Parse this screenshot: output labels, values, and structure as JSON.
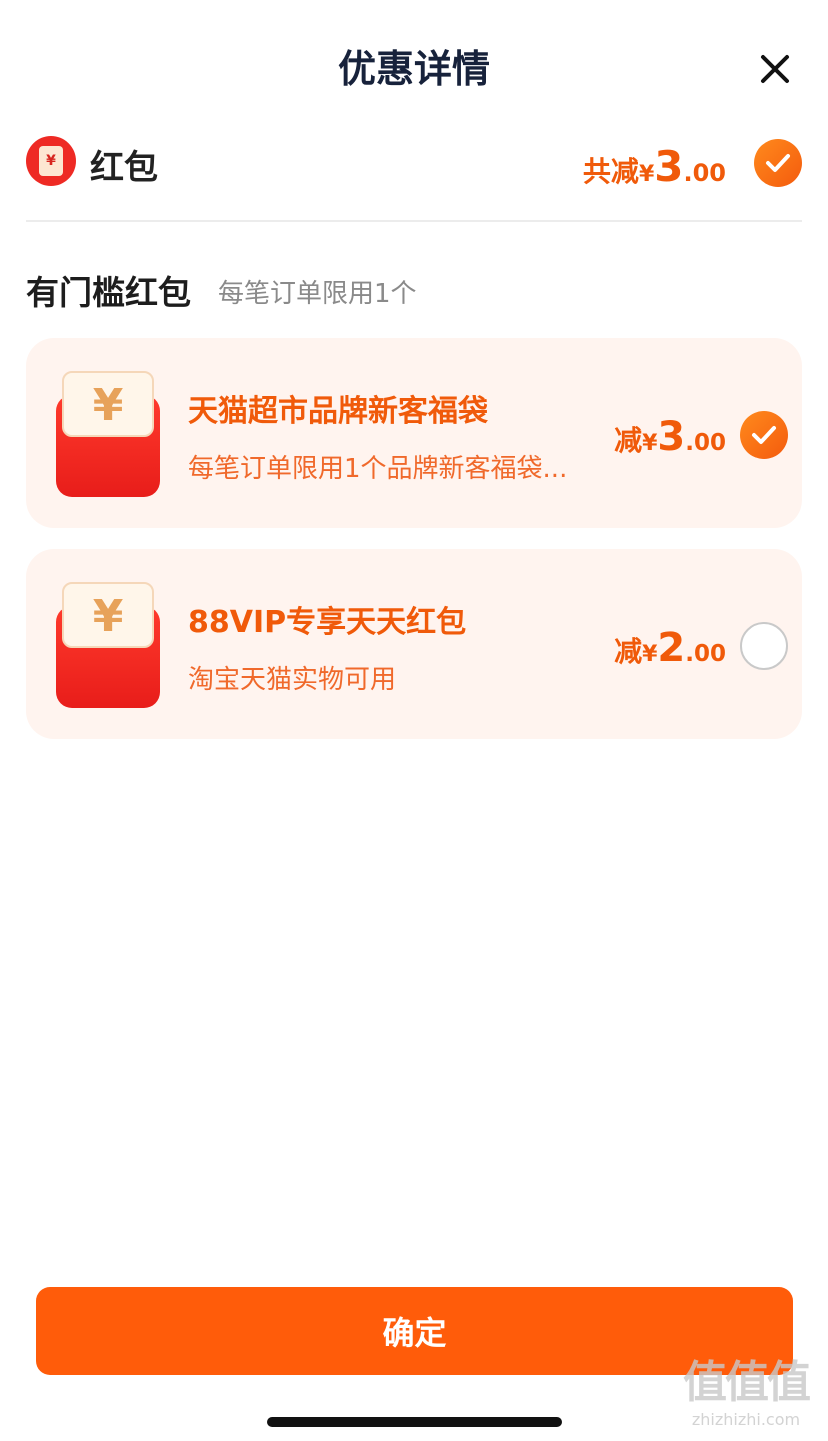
{
  "header": {
    "title": "优惠详情"
  },
  "section": {
    "icon_char": "¥",
    "label": "红包",
    "total": {
      "prefix": "共减",
      "currency": "¥",
      "integer": "3",
      "decimal": ".00"
    },
    "checked": true
  },
  "group": {
    "title": "有门槛红包",
    "subtitle": "每笔订单限用1个"
  },
  "coupons": [
    {
      "title": "天猫超市品牌新客福袋",
      "desc": "每笔订单限用1个品牌新客福袋...",
      "amount": {
        "prefix": "减",
        "currency": "¥",
        "integer": "3",
        "decimal": ".00"
      },
      "checked": true,
      "icon_char": "¥"
    },
    {
      "title": "88VIP专享天天红包",
      "desc": "淘宝天猫实物可用",
      "amount": {
        "prefix": "减",
        "currency": "¥",
        "integer": "2",
        "decimal": ".00"
      },
      "checked": false,
      "icon_char": "¥"
    }
  ],
  "footer": {
    "confirm_label": "确定"
  },
  "watermark": {
    "logo": "值值值",
    "text": "zhizhizhi.com"
  },
  "colors": {
    "accent": "#f05a0a",
    "button": "#ff5c0a",
    "card_bg": "#fff4ef",
    "title": "#17223b"
  }
}
